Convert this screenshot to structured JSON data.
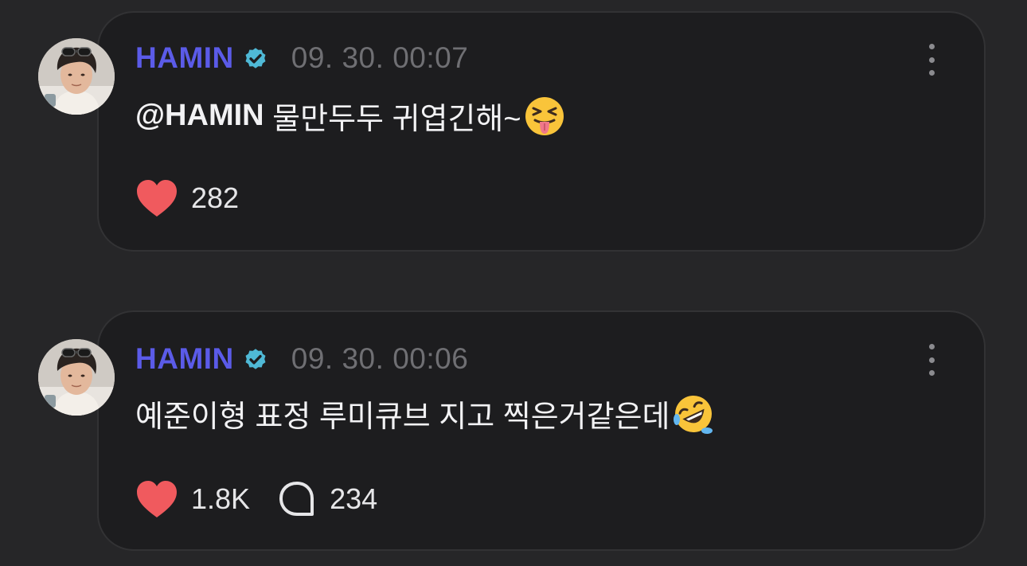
{
  "posts": [
    {
      "author": "HAMIN",
      "timestamp": "09. 30. 00:07",
      "mention": "@HAMIN",
      "text": " 물만두두 귀엽긴해~",
      "emoji": "squinting-tongue-face",
      "likes": "282",
      "comments": null
    },
    {
      "author": "HAMIN",
      "timestamp": "09. 30. 00:06",
      "mention": "",
      "text": "예준이형 표정 루미큐브 지고 찍은거같은데",
      "emoji": "rolling-on-floor-laughing-face",
      "likes": "1.8K",
      "comments": "234"
    }
  ],
  "colors": {
    "background": "#262628",
    "card": "#1d1d1f",
    "name": "#5b5be8",
    "verified": "#4fb9d6",
    "heart": "#f05a5e",
    "timestamp": "#6f6f73"
  },
  "icons": {
    "verified": "verified-badge-icon",
    "like": "heart-icon",
    "comment": "comment-bubble-icon",
    "more": "more-options-icon"
  }
}
